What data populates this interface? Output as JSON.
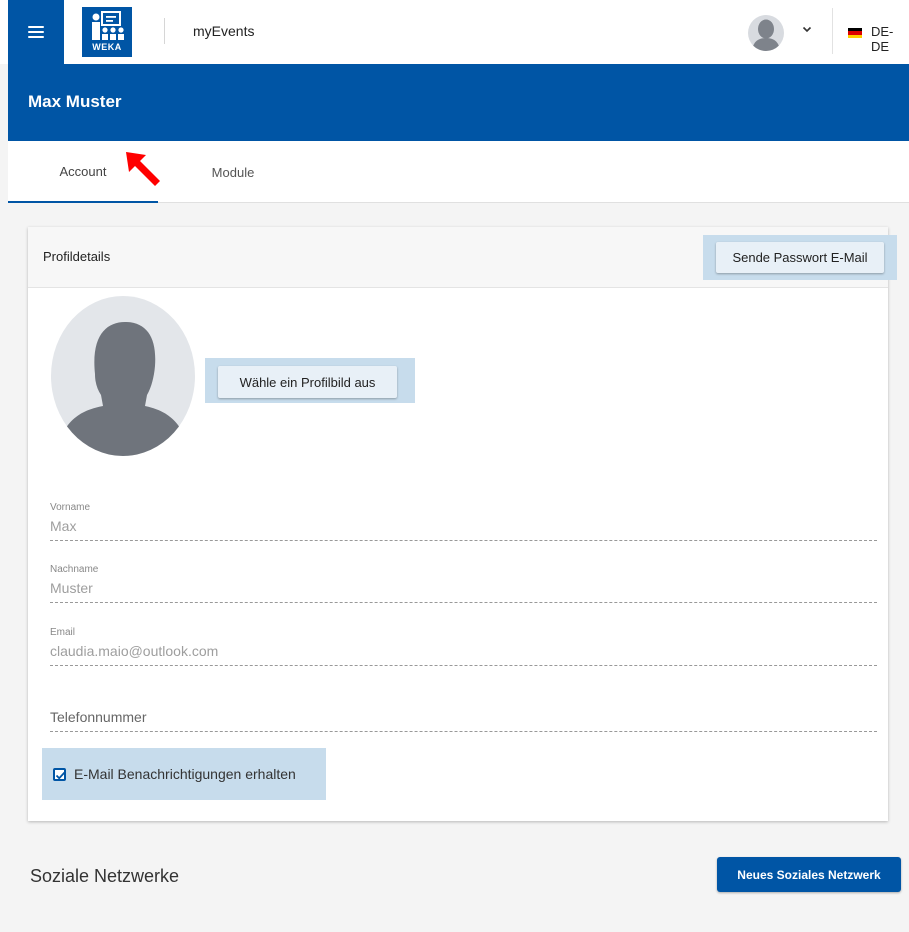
{
  "header": {
    "app_name": "myEvents",
    "logo_text": "WEKA",
    "language": "DE-DE",
    "flag_colors": [
      "#000000",
      "#dd0000",
      "#ffce00"
    ]
  },
  "user": {
    "name": "Max Muster"
  },
  "tabs": [
    {
      "label": "Account",
      "active": true
    },
    {
      "label": "Module",
      "active": false
    }
  ],
  "profile": {
    "title": "Profildetails",
    "send_password_label": "Sende Passwort E-Mail",
    "choose_picture_label": "Wähle ein Profilbild aus",
    "fields": {
      "firstname": {
        "label": "Vorname",
        "value": "Max"
      },
      "lastname": {
        "label": "Nachname",
        "value": "Muster"
      },
      "email": {
        "label": "Email",
        "value": "claudia.maio@outlook.com"
      },
      "phone": {
        "placeholder": "Telefonnummer"
      }
    },
    "notifications": {
      "label": "E-Mail Benachrichtigungen erhalten",
      "checked": true
    }
  },
  "social": {
    "title": "Soziale Netzwerke",
    "add_label": "Neues Soziales Netzwerk"
  },
  "colors": {
    "brand": "#0055a5",
    "highlight": "#c7dcec",
    "annotation": "#ff0000"
  }
}
